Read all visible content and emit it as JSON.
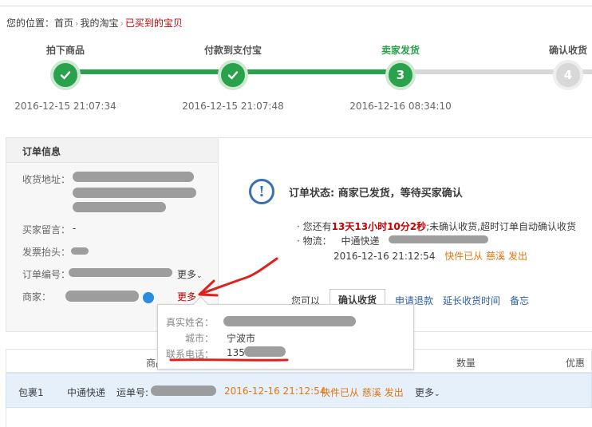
{
  "breadcrumb": {
    "prefix": "您的位置：",
    "items": [
      "首页",
      "我的淘宝",
      "已买到的宝贝"
    ],
    "separator": "›"
  },
  "progress": {
    "steps": [
      {
        "label": "拍下商品",
        "time": "2016-12-15 21:07:34",
        "state": "done"
      },
      {
        "label": "付款到支付宝",
        "time": "2016-12-15 21:07:48",
        "state": "done"
      },
      {
        "label": "卖家发货",
        "time": "2016-12-16 08:34:10",
        "state": "current",
        "number": "3"
      },
      {
        "label": "确认收货",
        "time": "",
        "state": "todo",
        "number": "4"
      }
    ],
    "colors": {
      "done": "#2aa14b",
      "todo": "#d8d8d8"
    }
  },
  "order_info": {
    "title": "订单信息",
    "address_label": "收货地址：",
    "buyer_message_label": "买家留言：",
    "buyer_message_value": "-",
    "invoice_label": "发票抬头：",
    "order_no_label": "订单编号：",
    "order_no_more": "更多",
    "merchant_label": "商家：",
    "merchant_more": "更多"
  },
  "status": {
    "title": "订单状态: 商家已发货，等待买家确认",
    "bullet": "·",
    "remain_prefix": "您还有",
    "remain_time": "13天13小时10分2秒",
    "remain_suffix": ";未确认收货,超时订单自动确认收货",
    "logistics_label": "物流：",
    "logistics_company": "中通快递",
    "logistics_time": "2016-12-16 21:12:54",
    "logistics_text": "快件已从",
    "logistics_place": "慈溪",
    "logistics_text2": "发出",
    "actions_label": "您可以",
    "confirm_button": "确认收货",
    "refund_link": "申请退款",
    "extend_link": "延长收货时间",
    "memo_link": "备忘"
  },
  "merchant_popup": {
    "name_label": "真实姓名：",
    "city_label": "城市：",
    "city_value": "宁波市",
    "phone_label": "联系电话：",
    "phone_value": "135"
  },
  "table": {
    "headers": [
      "商品",
      "数量",
      "优惠"
    ],
    "package": {
      "name": "包裹1",
      "company": "中通快递",
      "tracking_label": "运单号:",
      "time": "2016-12-16 21:12:54",
      "text": "快件已从",
      "place": "慈溪",
      "text2": "发出",
      "more": "更多"
    }
  },
  "colors": {
    "accent_green": "#2aa14b",
    "link_blue": "#2f5ea8",
    "warn_red": "#c40000",
    "annotation_red": "#e0201b"
  }
}
